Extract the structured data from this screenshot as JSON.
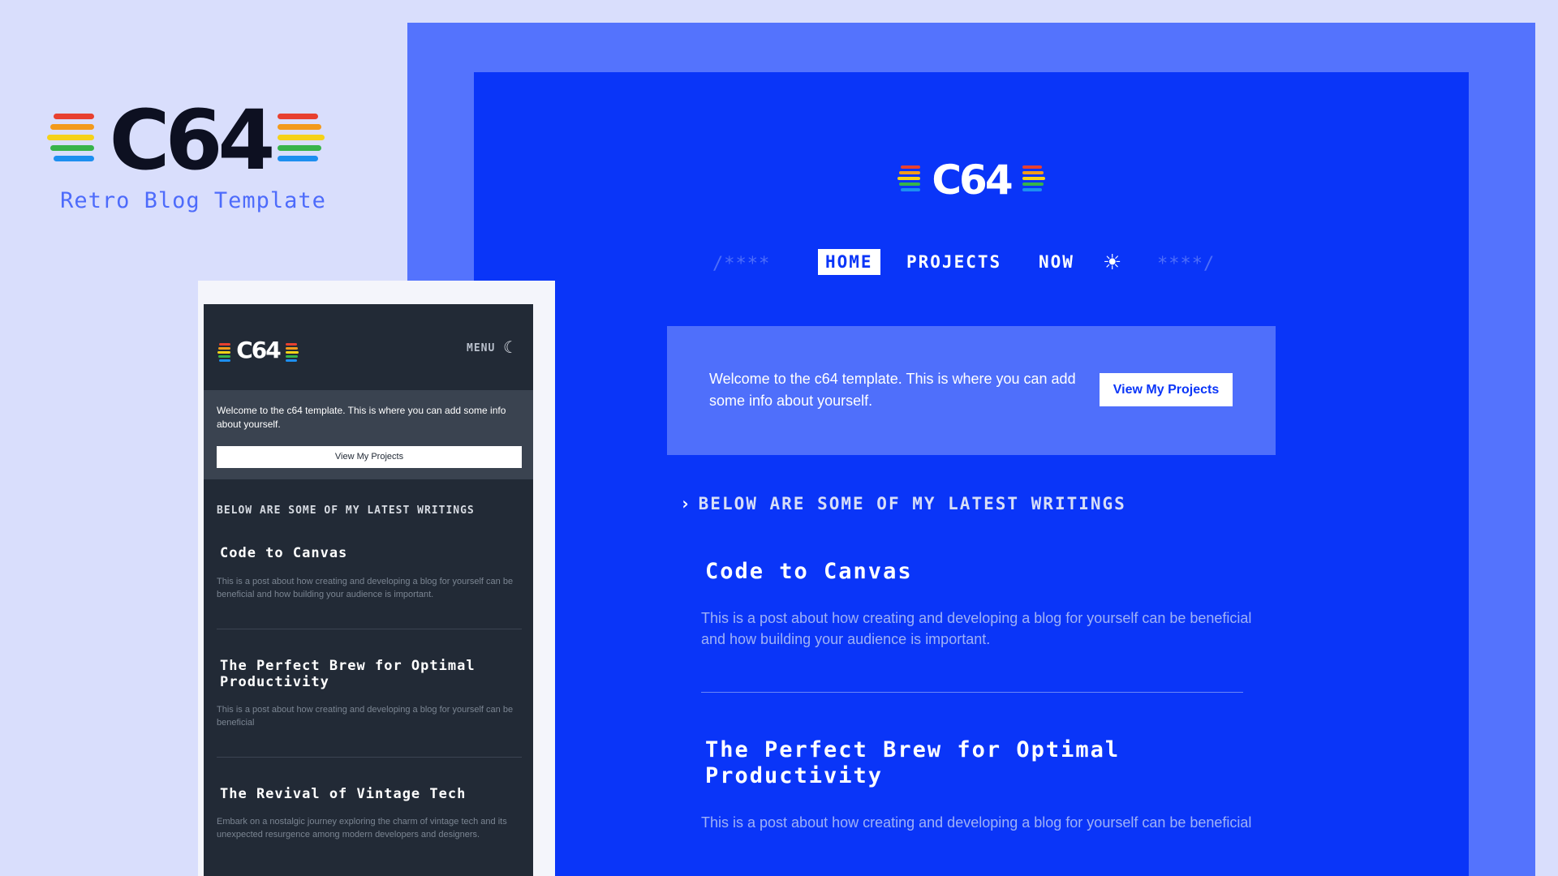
{
  "brand": {
    "logo_text": "C64",
    "subtitle": "Retro Blog Template",
    "stripe_colors": [
      "#e8402f",
      "#f39a1b",
      "#f5d218",
      "#37b44a",
      "#1d8ff0"
    ]
  },
  "desktop": {
    "logo_text": "C64",
    "nav": {
      "deco_left": "/****",
      "deco_right": "****/",
      "items": [
        {
          "label": "HOME",
          "active": true
        },
        {
          "label": "PROJECTS",
          "active": false
        },
        {
          "label": "NOW",
          "active": false
        }
      ],
      "theme_icon": "sun-icon"
    },
    "hero": {
      "text": "Welcome to the c64 template. This is where you can add some info about yourself.",
      "button_label": "View My Projects"
    },
    "section_heading": "BELOW ARE SOME OF MY LATEST WRITINGS",
    "posts": [
      {
        "title": "Code to Canvas",
        "description": "This is a post about how creating and developing a blog for yourself can be beneficial and how building your audience is important."
      },
      {
        "title": "The Perfect Brew for Optimal Productivity",
        "description": "This is a post about how creating and developing a blog for yourself can be beneficial"
      }
    ]
  },
  "mobile": {
    "logo_text": "C64",
    "menu_label": "MENU",
    "theme_icon": "moon-icon",
    "hero": {
      "text": "Welcome to the c64 template. This is where you can add some info about yourself.",
      "button_label": "View My Projects"
    },
    "section_heading": "BELOW ARE SOME OF MY LATEST WRITINGS",
    "posts": [
      {
        "title": "Code to Canvas",
        "description": "This is a post about how creating and developing a blog for yourself can be beneficial and how building your audience is important."
      },
      {
        "title": "The Perfect Brew for Optimal Productivity",
        "description": "This is a post about how creating and developing a blog for yourself can be beneficial"
      },
      {
        "title": "The Revival of Vintage Tech",
        "description": "Embark on a nostalgic journey exploring the charm of vintage tech and its unexpected resurgence among modern developers and designers."
      }
    ]
  },
  "colors": {
    "page_bg": "#d9defc",
    "desktop_frame": "#5473fd",
    "desktop_bg": "#0a35f8",
    "mobile_bg": "#222a36"
  }
}
